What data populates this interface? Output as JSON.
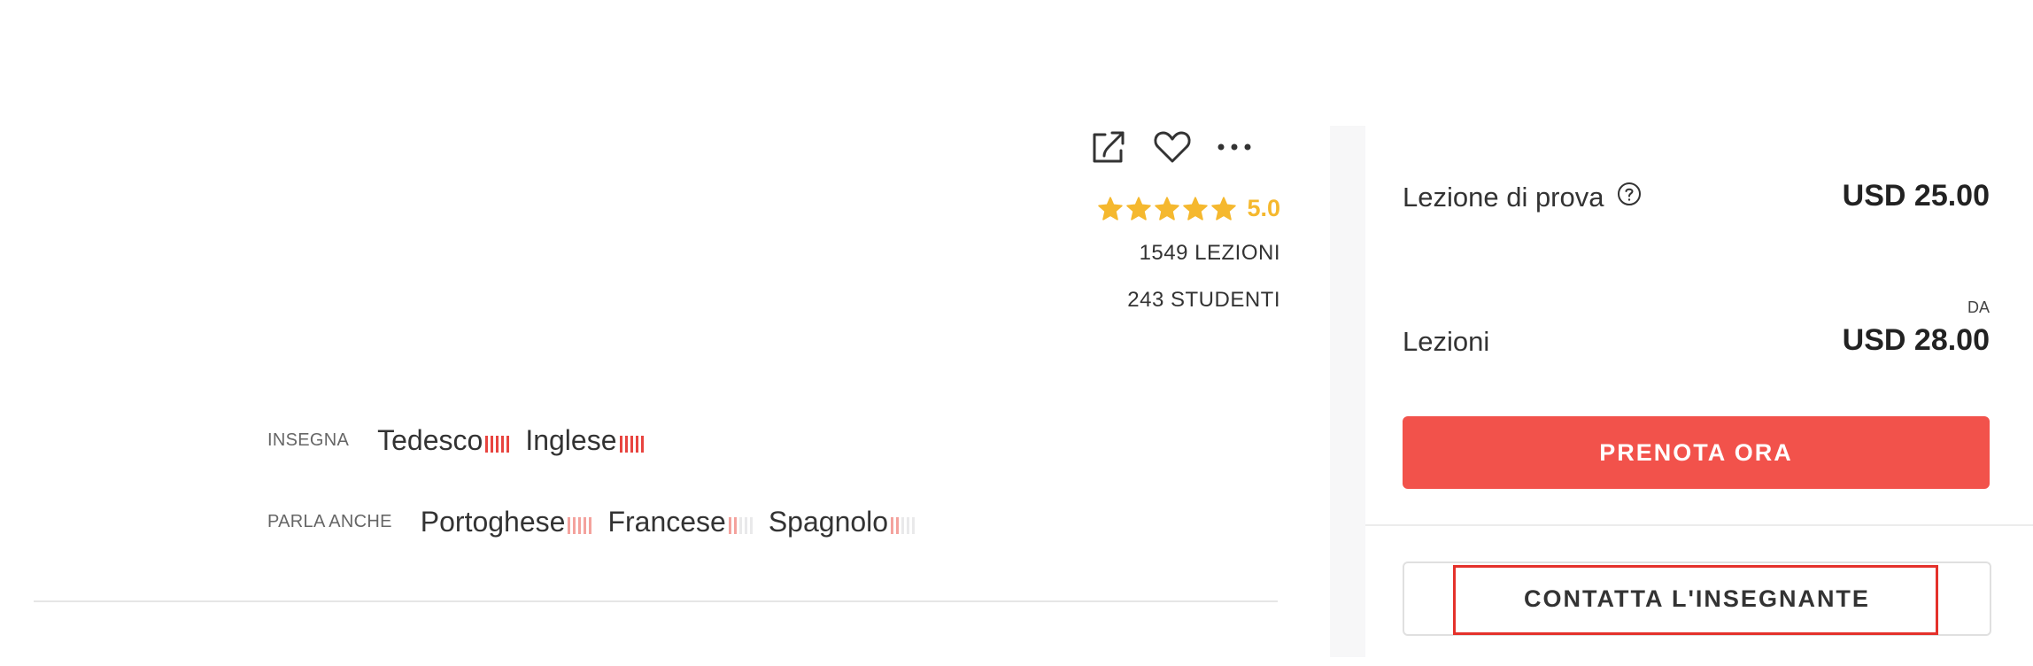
{
  "actions": {
    "share_icon": "share-icon",
    "favorite_icon": "heart-icon",
    "more_icon": "more-icon"
  },
  "rating": {
    "stars": 5,
    "score": "5.0"
  },
  "stats": {
    "lessons": "1549 LEZIONI",
    "students": "243 STUDENTI"
  },
  "teaches": {
    "label": "INSEGNA",
    "languages": [
      {
        "name": "Tedesco",
        "level": 5
      },
      {
        "name": "Inglese",
        "level": 5
      }
    ]
  },
  "speaks": {
    "label": "PARLA ANCHE",
    "languages": [
      {
        "name": "Portoghese",
        "level": 5
      },
      {
        "name": "Francese",
        "level": 2
      },
      {
        "name": "Spagnolo",
        "level": 2
      }
    ]
  },
  "pricing": {
    "trial_label": "Lezione di prova",
    "trial_price": "USD 25.00",
    "lessons_label": "Lezioni",
    "lessons_prefix": "DA",
    "lessons_price": "USD 28.00"
  },
  "buttons": {
    "book": "PRENOTA ORA",
    "contact": "CONTATTA L'INSEGNANTE"
  },
  "colors": {
    "accent": "#f2524b",
    "star": "#f5b82e",
    "bar_strong": "#e8443f",
    "bar_light": "#f4a29d",
    "bar_empty": "#e9e9ea",
    "highlight": "#e4312b"
  }
}
